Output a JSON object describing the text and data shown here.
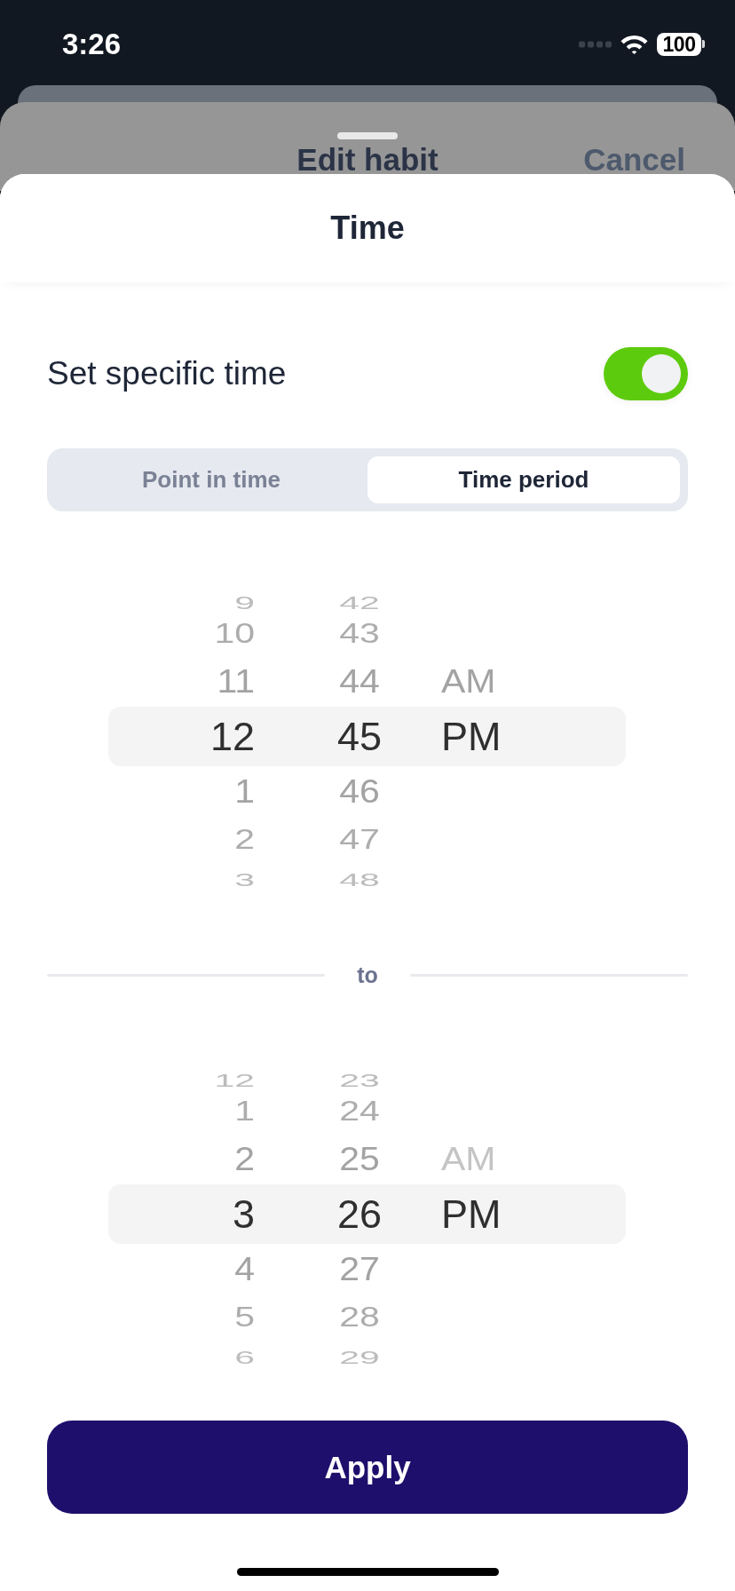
{
  "status_bar": {
    "time": "3:26",
    "battery": "100"
  },
  "parent_sheet": {
    "title": "Edit habit",
    "action": "Cancel"
  },
  "sheet": {
    "title": "Time"
  },
  "specific_time": {
    "label": "Set specific time",
    "on": true
  },
  "mode_tabs": [
    {
      "label": "Point in time",
      "selected": false
    },
    {
      "label": "Time period",
      "selected": true
    }
  ],
  "start_picker": {
    "columns": [
      {
        "kind": "hour",
        "items": [
          {
            "label": "9",
            "selected": false
          },
          {
            "label": "10",
            "selected": false
          },
          {
            "label": "11",
            "selected": false
          },
          {
            "label": "12",
            "selected": true
          },
          {
            "label": "1",
            "selected": false
          },
          {
            "label": "2",
            "selected": false
          },
          {
            "label": "3",
            "selected": false
          }
        ]
      },
      {
        "kind": "minute",
        "items": [
          {
            "label": "42",
            "selected": false
          },
          {
            "label": "43",
            "selected": false
          },
          {
            "label": "44",
            "selected": false
          },
          {
            "label": "45",
            "selected": true
          },
          {
            "label": "46",
            "selected": false
          },
          {
            "label": "47",
            "selected": false
          },
          {
            "label": "48",
            "selected": false
          }
        ]
      },
      {
        "kind": "period",
        "items": [
          {
            "label": "AM",
            "selected": false,
            "faint": false
          },
          {
            "label": "PM",
            "selected": true,
            "faint": false
          }
        ]
      }
    ]
  },
  "separator": {
    "label": "to"
  },
  "end_picker": {
    "columns": [
      {
        "kind": "hour",
        "items": [
          {
            "label": "12",
            "selected": false
          },
          {
            "label": "1",
            "selected": false
          },
          {
            "label": "2",
            "selected": false
          },
          {
            "label": "3",
            "selected": true
          },
          {
            "label": "4",
            "selected": false
          },
          {
            "label": "5",
            "selected": false
          },
          {
            "label": "6",
            "selected": false
          }
        ]
      },
      {
        "kind": "minute",
        "items": [
          {
            "label": "23",
            "selected": false
          },
          {
            "label": "24",
            "selected": false
          },
          {
            "label": "25",
            "selected": false
          },
          {
            "label": "26",
            "selected": true
          },
          {
            "label": "27",
            "selected": false
          },
          {
            "label": "28",
            "selected": false
          },
          {
            "label": "29",
            "selected": false
          }
        ]
      },
      {
        "kind": "period",
        "items": [
          {
            "label": "AM",
            "selected": false,
            "faint": true
          },
          {
            "label": "PM",
            "selected": true,
            "faint": false
          }
        ]
      }
    ]
  },
  "apply_button": {
    "label": "Apply"
  }
}
